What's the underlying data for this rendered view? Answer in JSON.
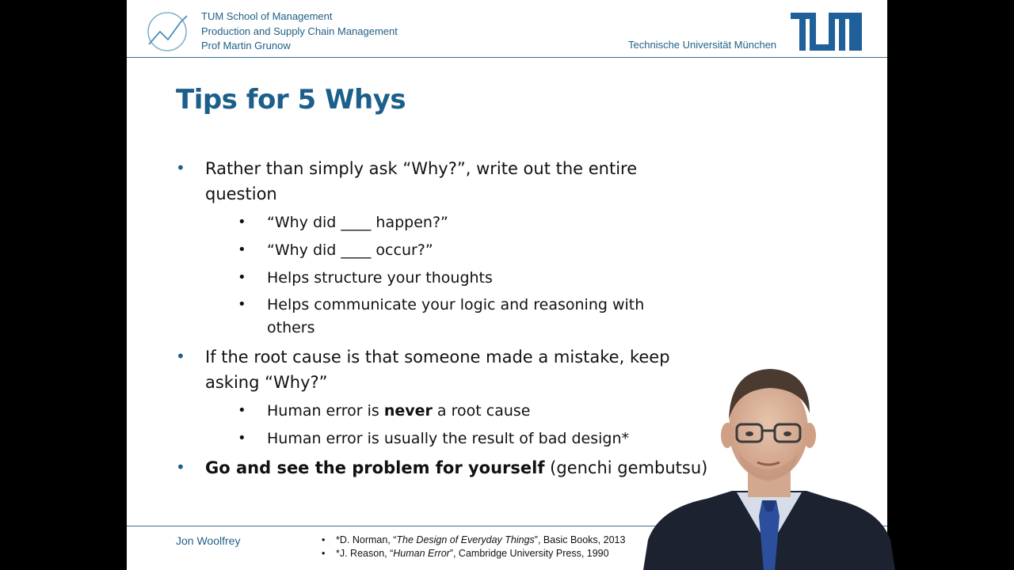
{
  "header": {
    "school_lines": [
      "TUM School of Management",
      "Production and Supply Chain Management",
      "Prof Martin Grunow"
    ],
    "university": "Technische Universität München",
    "logo_icon": "tum-logo"
  },
  "slide": {
    "title": "Tips for 5 Whys",
    "bullets": {
      "b1_line1": "Rather than simply ask “Why?”, write out the entire",
      "b1_line2": "question",
      "b1_sub1": "“Why did ____ happen?”",
      "b1_sub2": "“Why did ____ occur?”",
      "b1_sub3": "Helps structure your thoughts",
      "b1_sub4_line1": "Helps communicate your logic and reasoning with",
      "b1_sub4_line2": "others",
      "b2_line1": "If the root cause is that someone made a mistake, keep",
      "b2_line2": "asking “Why?”",
      "b2_sub1_pre": "Human error is ",
      "b2_sub1_bold": "never",
      "b2_sub1_post": " a root cause",
      "b2_sub2": "Human error is usually the result of bad design*",
      "b3_bold": "Go and see the problem for yourself",
      "b3_rest": " (genchi gembutsu)"
    }
  },
  "footer": {
    "author": "Jon Woolfrey",
    "ref1_pre": "*D. Norman, “",
    "ref1_title": "The Design of Everyday Things",
    "ref1_post": "”, Basic Books, 2013",
    "ref2_pre": "*J. Reason, “",
    "ref2_title": "Human Error",
    "ref2_post": "”, Cambridge University Press, 1990"
  },
  "colors": {
    "accent": "#1b5f8a",
    "text": "#111111",
    "background": "#ffffff"
  }
}
